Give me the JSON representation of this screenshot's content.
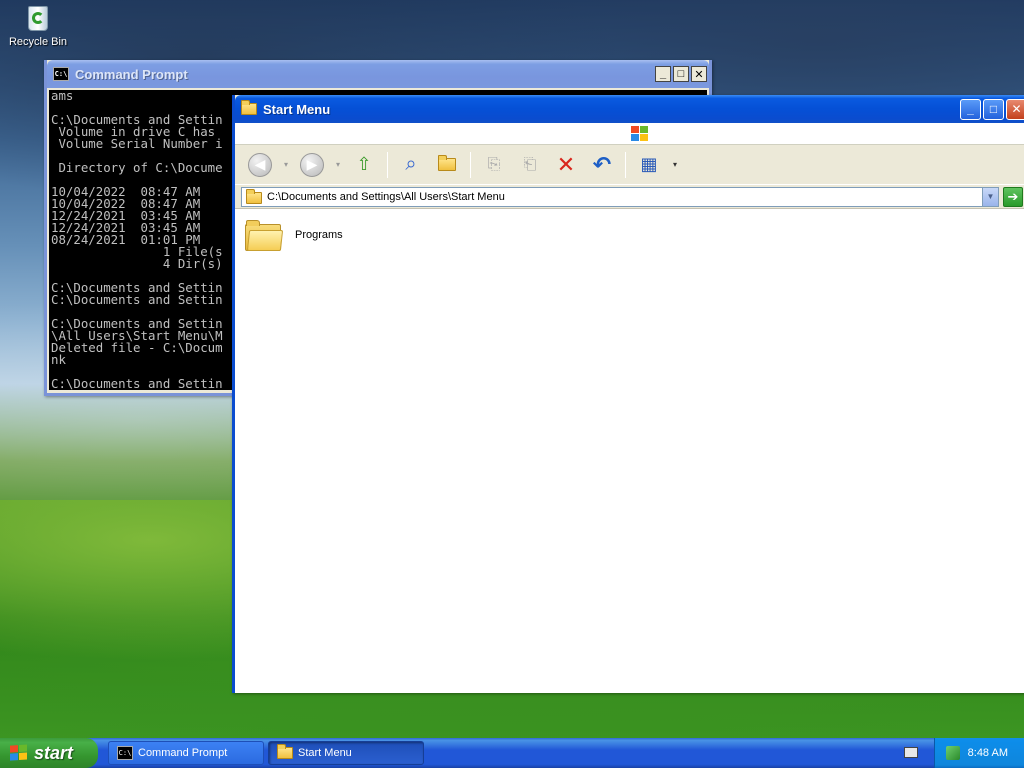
{
  "desktop": {
    "icons": [
      {
        "label": "Recycle Bin",
        "icon": "recycle-bin-icon"
      }
    ]
  },
  "cmd_window": {
    "title": "Command Prompt",
    "lines": [
      "ams",
      "",
      "C:\\Documents and Settin",
      " Volume in drive C has",
      " Volume Serial Number i",
      "",
      " Directory of C:\\Docume",
      "",
      "10/04/2022  08:47 AM",
      "10/04/2022  08:47 AM",
      "12/24/2021  03:45 AM",
      "12/24/2021  03:45 AM",
      "08/24/2021  01:01 PM",
      "               1 File(s",
      "               4 Dir(s)",
      "",
      "C:\\Documents and Settin",
      "C:\\Documents and Settin",
      "",
      "C:\\Documents and Settin",
      "\\All Users\\Start Menu\\M",
      "Deleted file - C:\\Docum",
      "nk",
      "",
      "C:\\Documents and Settin"
    ]
  },
  "explorer": {
    "title": "Start Menu",
    "address": "C:\\Documents and Settings\\All Users\\Start Menu",
    "toolbar": [
      "back-icon",
      "forward-icon",
      "up-folder-icon",
      "search-icon",
      "folders-icon",
      "move-to-icon",
      "copy-to-icon",
      "delete-icon",
      "undo-icon",
      "views-icon"
    ],
    "items": [
      {
        "label": "Programs",
        "icon": "folder-icon"
      }
    ]
  },
  "taskbar": {
    "start_label": "start",
    "tasks": [
      {
        "label": "Command Prompt",
        "icon": "cmd-icon"
      },
      {
        "label": "Start Menu",
        "icon": "folder-icon"
      }
    ],
    "clock": "8:48 AM"
  },
  "colors": {
    "title_active": "#0a4ccf",
    "title_inactive": "#7b98de",
    "taskbar": "#2157d7",
    "start": "#35962f"
  }
}
